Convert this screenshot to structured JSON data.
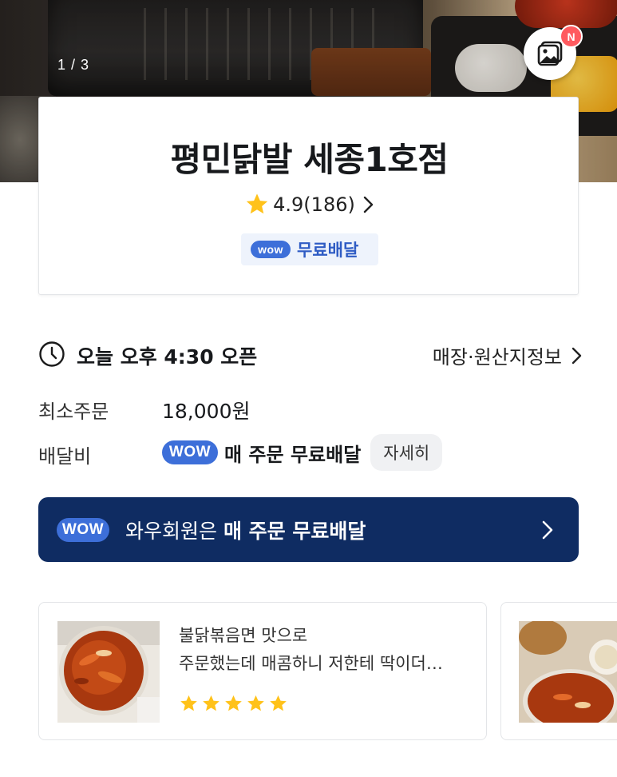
{
  "hero": {
    "page_counter": "1 / 3",
    "gallery_badge": "N"
  },
  "store": {
    "name": "평민닭발 세종1호점",
    "rating": "4.9(186)",
    "wow_label": "wow",
    "free_delivery": "무료배달"
  },
  "info": {
    "open_text": "오늘 오후 4:30 오픈",
    "store_info_link": "매장·원산지정보",
    "min_order_label": "최소주문",
    "min_order_value": "18,000원",
    "delivery_fee_label": "배달비",
    "delivery_fee_wow": "WOW",
    "delivery_fee_text": "매 주문 무료배달",
    "detail_button": "자세히"
  },
  "wow_banner": {
    "wow_label": "WOW",
    "text_prefix": "와우회원은 ",
    "text_bold": "매 주문 무료배달"
  },
  "reviews": [
    {
      "line1": "불닭볶음면 맛으로",
      "line2": "주문했는데 매콤하니 저한테 딱이더…",
      "stars": 5
    }
  ],
  "colors": {
    "wow_blue": "#3d6fd9",
    "banner_navy": "#0f2c62",
    "star_yellow": "#ffc21a",
    "badge_red": "#ff5a5f"
  },
  "icons": [
    "gallery-icon",
    "star-icon",
    "chevron-right-icon",
    "clock-icon"
  ]
}
